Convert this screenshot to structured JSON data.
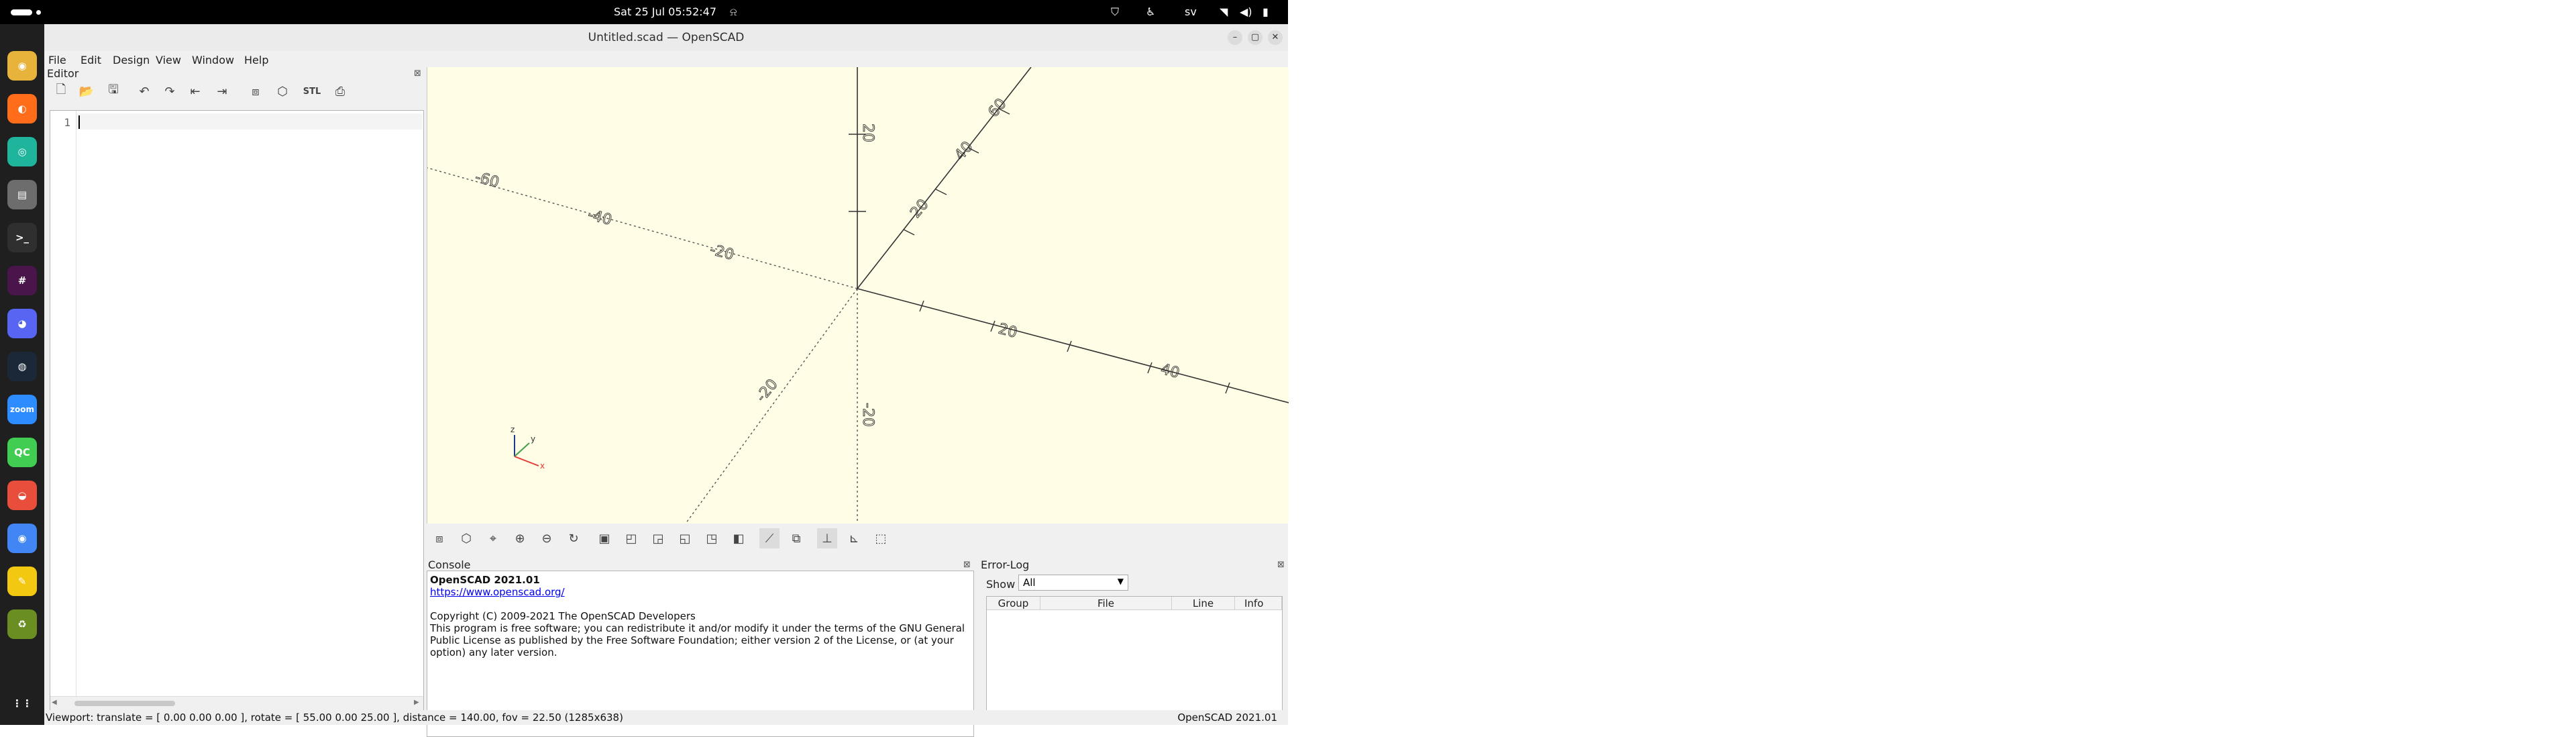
{
  "topbar": {
    "clock": "Sat 25 Jul  05:52:47",
    "tray_language": "sv"
  },
  "dock": {
    "items": [
      {
        "name": "chrome-icon",
        "color": "#e8b33b"
      },
      {
        "name": "firefox-icon",
        "color": "#ff6d1a"
      },
      {
        "name": "gitkraken-icon",
        "color": "#1fb59d"
      },
      {
        "name": "files-icon",
        "color": "#6d6d6d"
      },
      {
        "name": "terminal-icon",
        "color": "#2f2f2f"
      },
      {
        "name": "slack-icon",
        "color": "#4a154b"
      },
      {
        "name": "discord-icon",
        "color": "#5865f2"
      },
      {
        "name": "steam-icon",
        "color": "#1b2838"
      },
      {
        "name": "zoom-icon",
        "color": "#2d8cff",
        "label": "zoom"
      },
      {
        "name": "qt-creator-icon",
        "color": "#41cd52",
        "label": "QC"
      },
      {
        "name": "openscad-icon",
        "color": "#e94e3c"
      },
      {
        "name": "chromium-icon",
        "color": "#4285f4"
      },
      {
        "name": "text-editor-icon",
        "color": "#f2c811"
      },
      {
        "name": "trash-icon",
        "color": "#6b8e23"
      },
      {
        "name": "show-apps-icon",
        "color": "#1f1f1f"
      }
    ]
  },
  "window": {
    "title": "Untitled.scad — OpenSCAD"
  },
  "menubar": {
    "file": "File",
    "edit": "Edit",
    "design": "Design",
    "view": "View",
    "window": "Window",
    "help": "Help"
  },
  "editor": {
    "label": "Editor",
    "line_number": "1",
    "toolbar": {
      "stl_label": "STL"
    }
  },
  "viewport": {
    "axis_labels": {
      "x_pos_20": "20",
      "x_pos_40": "40",
      "x_neg_20": "-20",
      "x_neg_40": "-40",
      "x_neg_60": "-60",
      "y_pos_20": "20",
      "y_pos_40": "40",
      "y_pos_60": "60",
      "y_neg_20": "-20",
      "z_pos_20": "20",
      "z_neg_20": "-20"
    },
    "gizmo": {
      "z_label": "z",
      "y_label": "y",
      "x_label": "x"
    }
  },
  "console": {
    "label": "Console",
    "version_line": "OpenSCAD 2021.01",
    "url": "https://www.openscad.org/",
    "copyright": "Copyright (C) 2009-2021 The OpenSCAD Developers",
    "license_line1": "This program is free software; you can redistribute it and/or modify it under the terms of the GNU General",
    "license_line2": "Public License as published by the Free Software Foundation; either version 2 of the License, or (at your",
    "license_line3": "option) any later version."
  },
  "errorlog": {
    "label": "Error-Log",
    "show_label": "Show",
    "show_value": "All",
    "columns": [
      "Group",
      "File",
      "Line",
      "Info"
    ]
  },
  "statusbar": {
    "viewport_info": "Viewport: translate = [ 0.00 0.00 0.00 ], rotate = [ 55.00 0.00 25.00 ], distance = 140.00, fov = 22.50 (1285x638)",
    "version": "OpenSCAD 2021.01"
  },
  "colors": {
    "viewport_background": "#fffde6",
    "axis_line": "#333333",
    "gizmo_x": "#e53935",
    "gizmo_y": "#43a047",
    "gizmo_z": "#1e3a8a"
  }
}
